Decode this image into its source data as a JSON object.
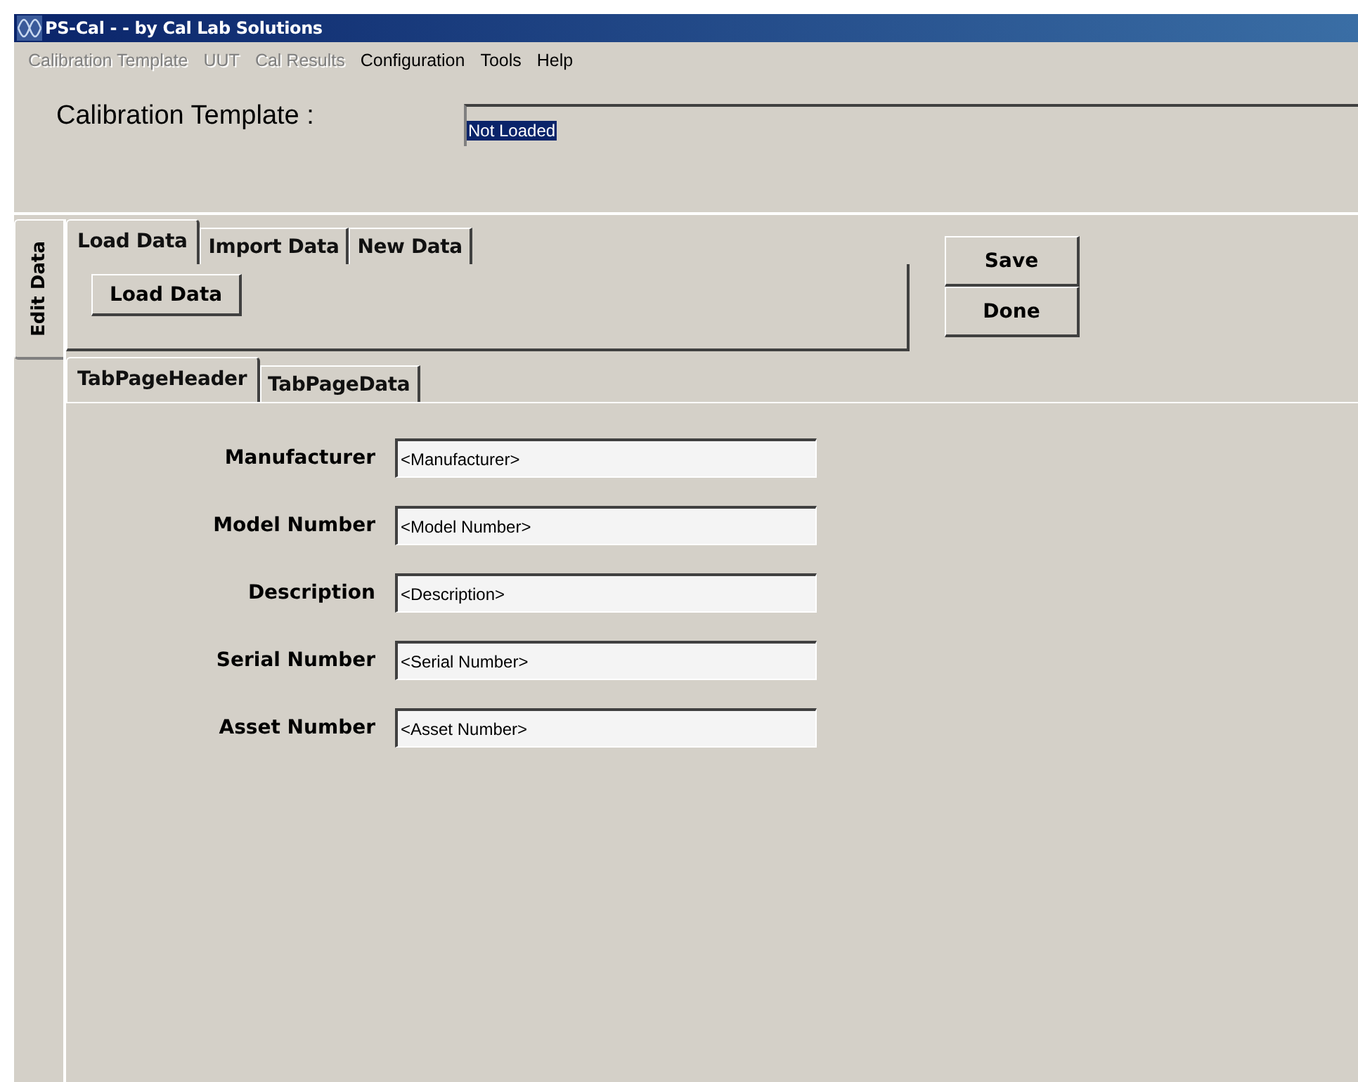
{
  "window": {
    "title": "PS-Cal - - by Cal Lab Solutions"
  },
  "menu": [
    {
      "label": "Calibration Template",
      "disabled": true
    },
    {
      "label": "UUT",
      "disabled": true
    },
    {
      "label": "Cal Results",
      "disabled": true
    },
    {
      "label": "Configuration",
      "disabled": false
    },
    {
      "label": "Tools",
      "disabled": false
    },
    {
      "label": "Help",
      "disabled": false
    }
  ],
  "template": {
    "label": "Calibration Template :",
    "value": "Not Loaded"
  },
  "side_tabs": [
    {
      "label": "Edit Data",
      "selected": true
    }
  ],
  "data_tabs": [
    {
      "label": "Load Data",
      "selected": true
    },
    {
      "label": "Import Data",
      "selected": false
    },
    {
      "label": "New Data",
      "selected": false
    }
  ],
  "load_button": "Load Data",
  "buttons": [
    "Save",
    "Done"
  ],
  "page_tabs": [
    {
      "label": "TabPageHeader",
      "selected": true
    },
    {
      "label": "TabPageData",
      "selected": false
    }
  ],
  "fields": [
    {
      "label": "Manufacturer",
      "value": "<Manufacturer>"
    },
    {
      "label": "Model Number",
      "value": "<Model Number>"
    },
    {
      "label": "Description",
      "value": "<Description>"
    },
    {
      "label": "Serial Number",
      "value": "<Serial Number>"
    },
    {
      "label": "Asset Number",
      "value": "<Asset Number>"
    }
  ]
}
